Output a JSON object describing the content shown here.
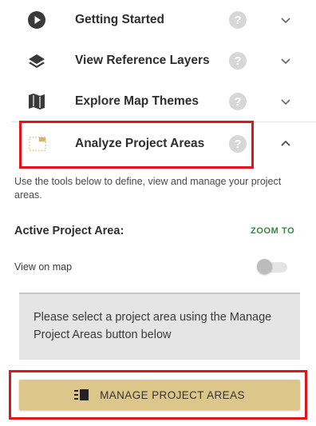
{
  "accordion": {
    "items": [
      {
        "label": "Getting Started",
        "icon": "play-circle-icon",
        "expanded": false
      },
      {
        "label": "View Reference Layers",
        "icon": "layers-icon",
        "expanded": false
      },
      {
        "label": "Explore Map Themes",
        "icon": "map-icon",
        "expanded": false
      },
      {
        "label": "Analyze Project Areas",
        "icon": "project-area-icon",
        "expanded": true
      }
    ],
    "help_glyph": "?"
  },
  "panel": {
    "description": "Use the tools below to define, view and manage your project areas.",
    "active_label": "Active Project Area:",
    "zoom_label": "ZOOM TO",
    "view_on_map_label": "View on map",
    "view_on_map_on": false,
    "notice": "Please select a project area using the Manage Project Areas button below",
    "manage_button": "MANAGE PROJECT AREAS"
  },
  "colors": {
    "highlight": "#e3141d",
    "zoom_accent": "#2e8b3e",
    "button_bg": "#dcc689"
  }
}
